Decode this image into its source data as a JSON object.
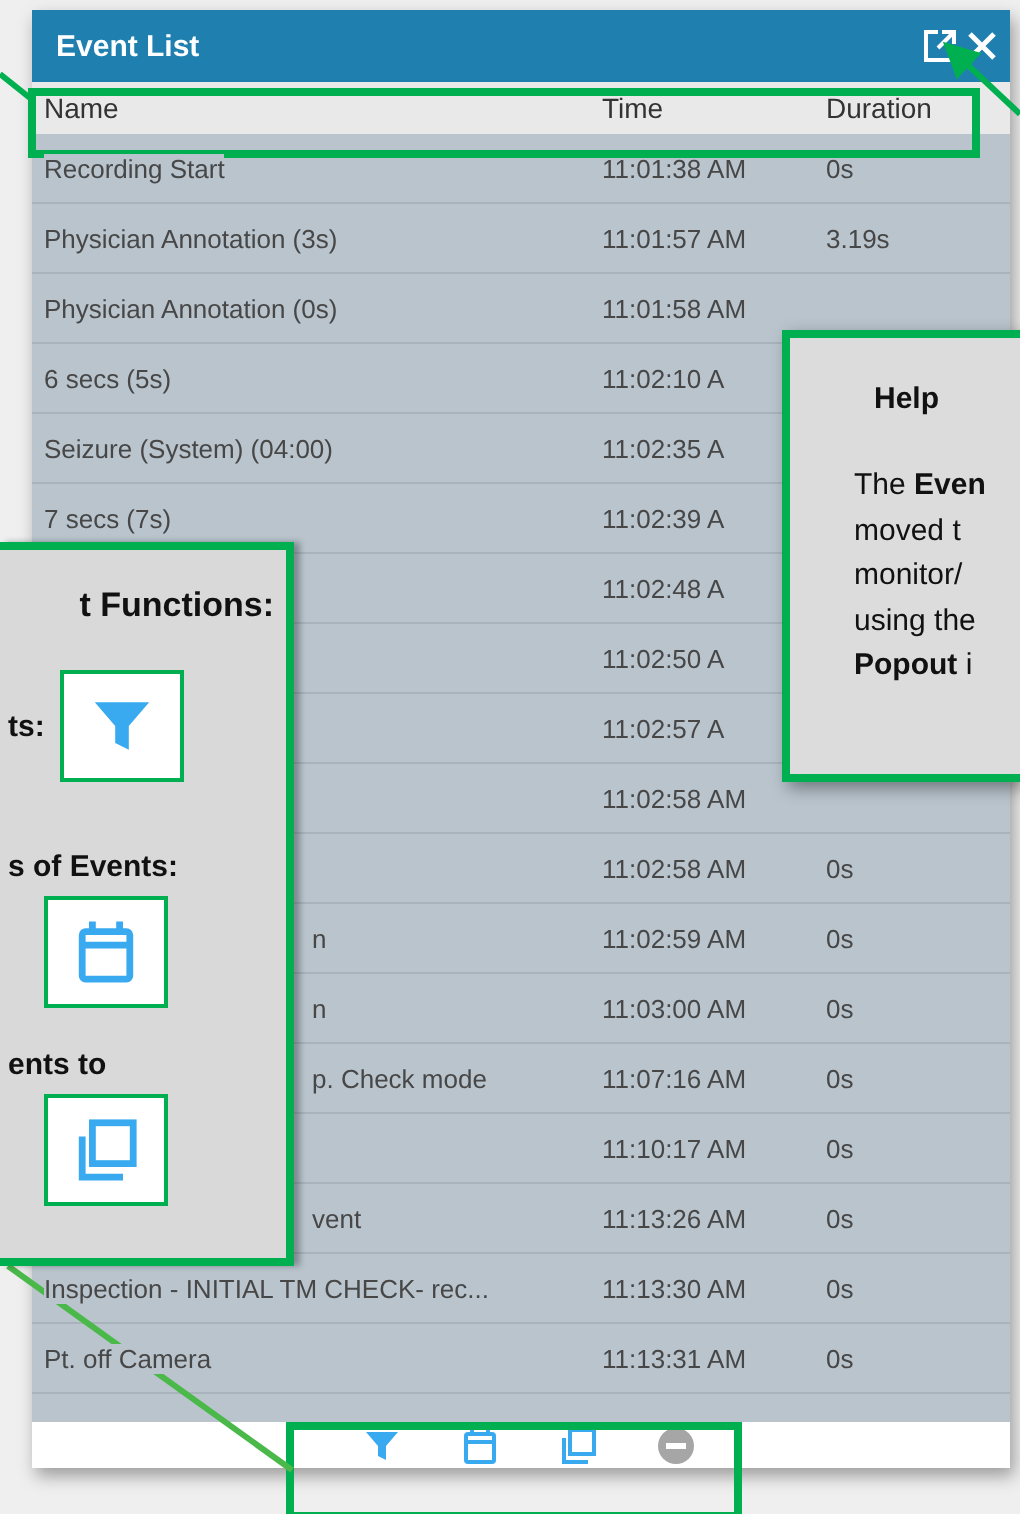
{
  "window": {
    "title": "Event List"
  },
  "table": {
    "columns": [
      "Name",
      "Time",
      "Duration"
    ],
    "rows": [
      {
        "kind": "plain",
        "name": "Recording Start",
        "time": "11:01:38 AM",
        "duration": "0s"
      },
      {
        "kind": "plain",
        "name": "Physician Annotation (3s)",
        "time": "11:01:57 AM",
        "duration": "3.19s"
      },
      {
        "kind": "plain",
        "name": "Physician Annotation (0s)",
        "time": "11:01:58 AM"
      },
      {
        "kind": "plain",
        "name": "6 secs (5s)",
        "time": "11:02:10 A"
      },
      {
        "kind": "plain",
        "name": "Seizure (System) (04:00)",
        "time": "11:02:35 A"
      },
      {
        "kind": "plain",
        "name": "7 secs (7s)",
        "time": "11:02:39 A"
      },
      {
        "kind": "covered",
        "time": "11:02:48 A"
      },
      {
        "kind": "covered",
        "time": "11:02:50 A"
      },
      {
        "kind": "covered",
        "time": "11:02:57 A"
      },
      {
        "kind": "covered",
        "time": "11:02:58 AM"
      },
      {
        "kind": "covered",
        "time": "11:02:58 AM",
        "duration": "0s"
      },
      {
        "kind": "covered",
        "name": "n",
        "time": "11:02:59 AM",
        "duration": "0s"
      },
      {
        "kind": "covered",
        "name": "n",
        "time": "11:03:00 AM",
        "duration": "0s"
      },
      {
        "kind": "covered",
        "name": "p. Check mode",
        "time": "11:07:16 AM",
        "duration": "0s"
      },
      {
        "kind": "covered",
        "time": "11:10:17 AM",
        "duration": "0s"
      },
      {
        "kind": "covered",
        "name": "vent",
        "time": "11:13:26 AM",
        "duration": "0s"
      },
      {
        "kind": "plain",
        "name": "Inspection - INITIAL TM CHECK- rec...",
        "time": "11:13:30 AM",
        "duration": "0s"
      },
      {
        "kind": "plain",
        "name": "Pt. off Camera",
        "time": "11:13:31 AM",
        "duration": "0s"
      }
    ]
  },
  "toolbar": {
    "buttons": [
      {
        "kind": "filter",
        "disabled": false
      },
      {
        "kind": "calendar",
        "disabled": false
      },
      {
        "kind": "copy",
        "disabled": false
      },
      {
        "kind": "remove",
        "disabled": true
      }
    ]
  },
  "callouts": {
    "functions": {
      "title": "t Functions:",
      "items": [
        {
          "label": "ts:"
        },
        {
          "label": "s of Events:"
        },
        {
          "label": "ents to"
        }
      ]
    },
    "help": {
      "title": "Help",
      "lines": [
        "The **Even**",
        "moved t",
        "monitor/",
        "using the",
        "**Popout** i"
      ]
    }
  }
}
